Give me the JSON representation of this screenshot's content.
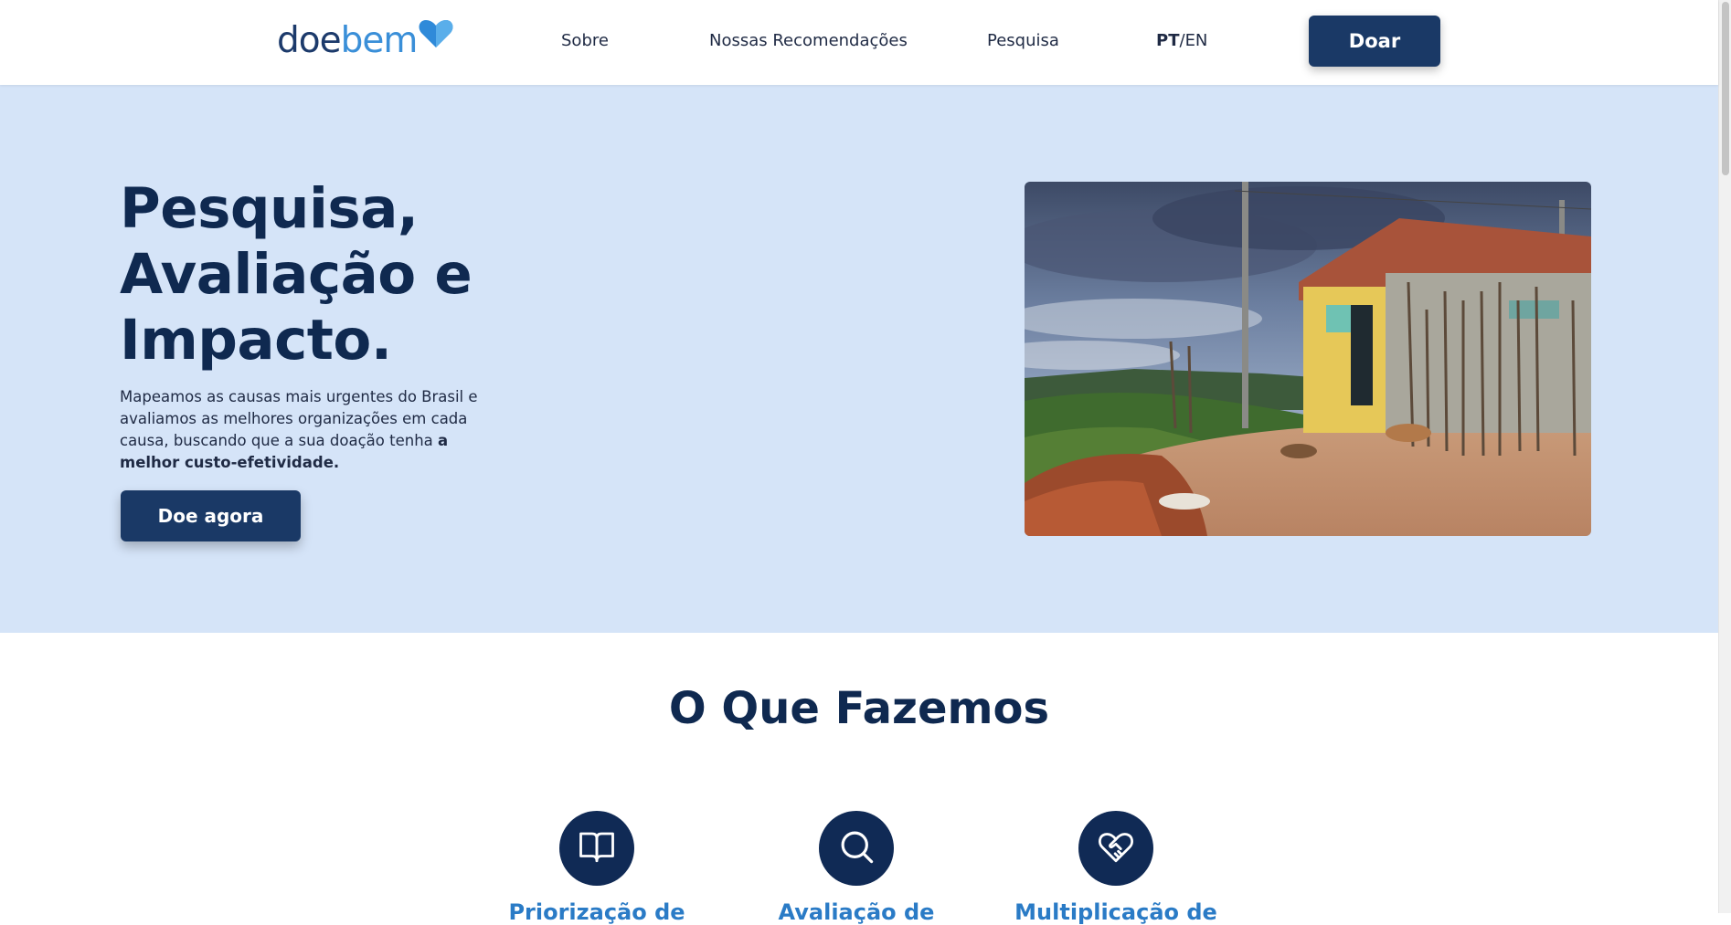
{
  "header": {
    "logo": {
      "part1": "doe",
      "part2": "bem"
    },
    "nav": [
      {
        "label": "Sobre"
      },
      {
        "label": "Nossas Recomendações"
      },
      {
        "label": "Pesquisa"
      }
    ],
    "lang": {
      "active": "PT",
      "separator": "/",
      "other": "EN"
    },
    "donate_label": "Doar"
  },
  "hero": {
    "title": "Pesquisa, Avaliação e Impacto.",
    "text": "Mapeamos as causas mais urgentes do Brasil e avaliamos as melhores organizações em cada causa, buscando que a sua doação tenha ",
    "text_bold": "a melhor custo-efetividade.",
    "cta_label": "Doe agora"
  },
  "section": {
    "title": "O Que Fazemos",
    "features": [
      {
        "icon": "book-icon",
        "label": "Priorização de"
      },
      {
        "icon": "search-icon",
        "label": "Avaliação de"
      },
      {
        "icon": "heart-handshake-icon",
        "label": "Multiplicação de"
      }
    ]
  },
  "colors": {
    "primary": "#1a3966",
    "accent": "#3a8fd8",
    "hero_bg": "#d5e4f8",
    "feature_label": "#2a7bc6"
  }
}
